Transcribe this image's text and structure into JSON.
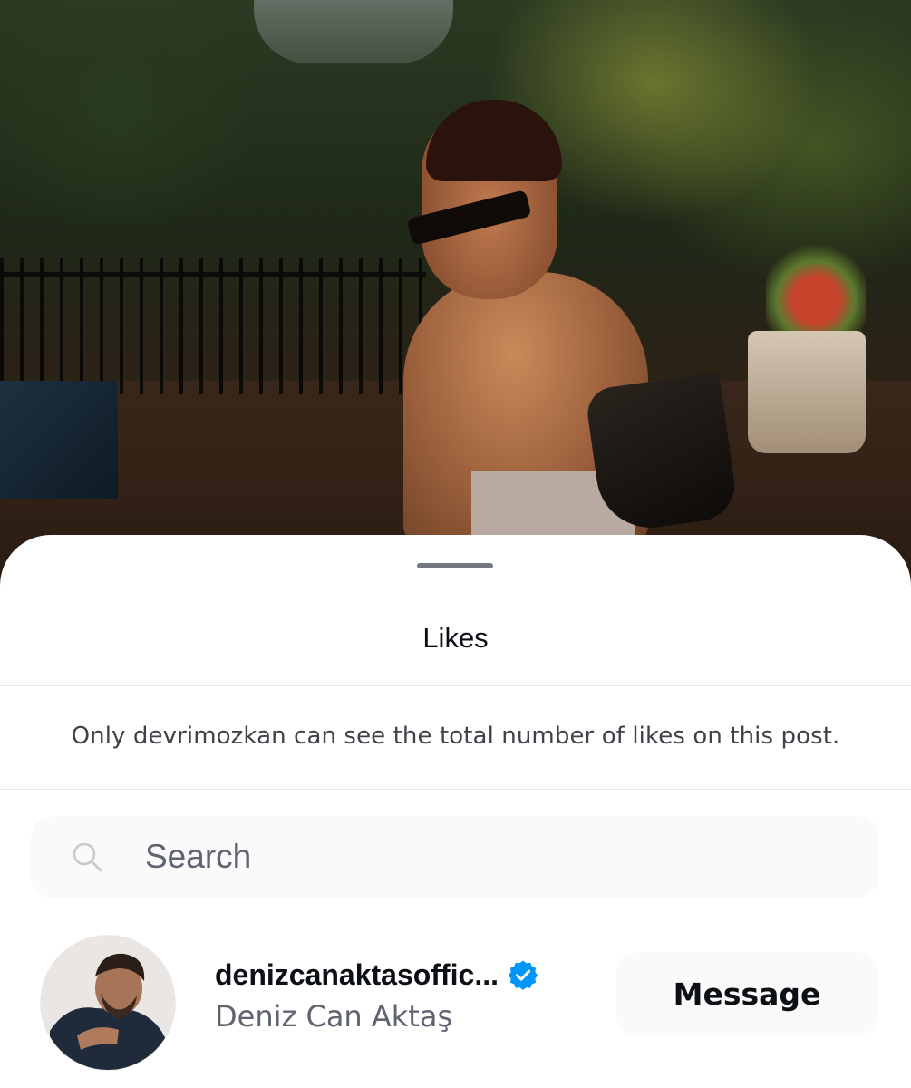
{
  "post_image": {
    "description_icon": "photo-background"
  },
  "sheet": {
    "title": "Likes",
    "notice": "Only devrimozkan can see the total number of likes on this post."
  },
  "search": {
    "placeholder": "Search",
    "value": ""
  },
  "likes": [
    {
      "username": "denizcanaktasoffic...",
      "full_name": "Deniz Can Aktaş",
      "verified": true,
      "action_label": "Message"
    }
  ],
  "colors": {
    "verified_badge": "#0095f6",
    "sheet_background": "#ffffff",
    "secondary_text": "#5f6470"
  }
}
